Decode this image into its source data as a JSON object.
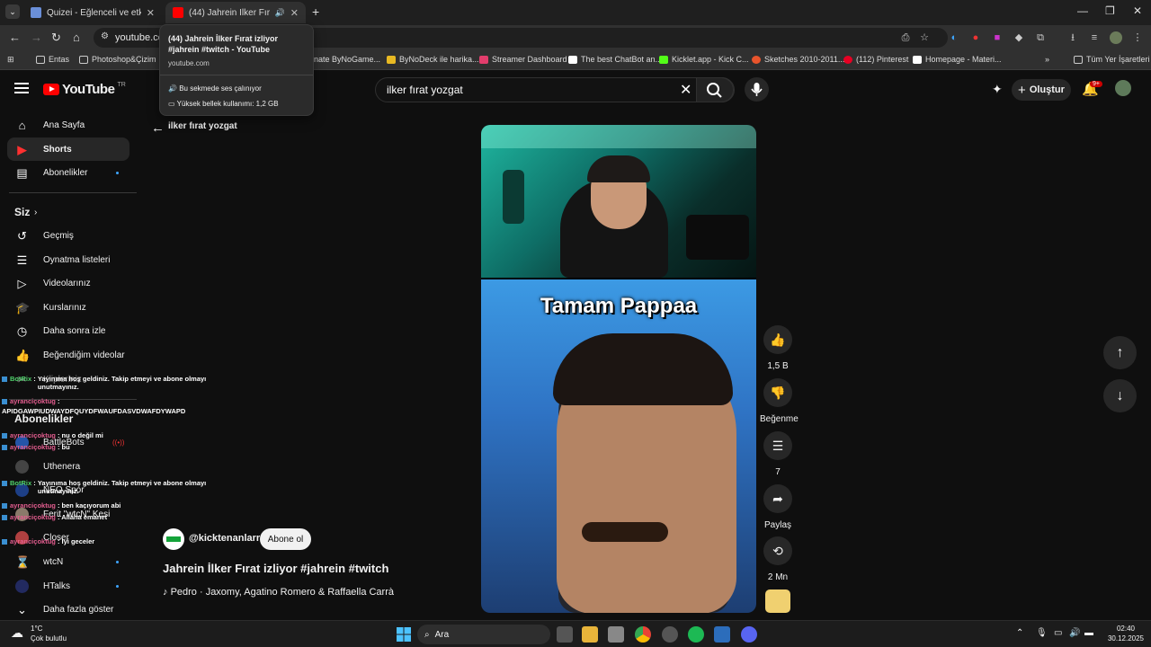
{
  "browser": {
    "tabs": [
      {
        "title": "Quizei - Eğlenceli ve etkileşimli",
        "active": false
      },
      {
        "title": "(44) Jahrein İlker Fırat izliyor",
        "active": true
      }
    ],
    "url": "youtube.com",
    "bookmarks": [
      "Entas",
      "Photoshop&Çizim",
      "onate ByNoGame...",
      "ByNoDeck ile harika...",
      "Streamer Dashboard",
      "The best ChatBot an...",
      "Kicklet.app - Kick C...",
      "Sketches 2010-2011...",
      "(112) Pinterest",
      "Homepage - Materi...",
      "Tüm Yer İşaretleri"
    ],
    "tooltip": {
      "title": "(44) Jahrein İlker Fırat izliyor #jahrein #twitch - YouTube",
      "domain": "youtube.com",
      "audio": "Bu sekmede ses çalınıyor",
      "memory": "Yüksek bellek kullanımı: 1,2 GB"
    }
  },
  "header": {
    "logo": "YouTube",
    "logo_region": "TR",
    "search_query": "ilker fırat yozgat",
    "create_label": "Oluştur",
    "notifications": "9+"
  },
  "sidebar": {
    "main": [
      {
        "label": "Ana Sayfa",
        "icon": "home-icon"
      },
      {
        "label": "Shorts",
        "icon": "shorts-icon"
      },
      {
        "label": "Abonelikler",
        "icon": "subscriptions-icon"
      }
    ],
    "you_heading": "Siz",
    "you": [
      {
        "label": "Geçmiş",
        "icon": "history-icon"
      },
      {
        "label": "Oynatma listeleri",
        "icon": "playlists-icon"
      },
      {
        "label": "Videolarınız",
        "icon": "your-videos-icon"
      },
      {
        "label": "Kurslarınız",
        "icon": "courses-icon"
      },
      {
        "label": "Daha sonra izle",
        "icon": "watch-later-icon"
      },
      {
        "label": "Beğendiğim videolar",
        "icon": "liked-icon"
      },
      {
        "label": "Klipleriniz",
        "icon": "clips-icon"
      }
    ],
    "subs_heading": "Abonelikler",
    "subscriptions": [
      "BattleBots",
      "Uthenera",
      "NEO Spor",
      "Ferit \"wtcN\" Kesi",
      "Closer",
      "wtcN",
      "HTalks"
    ],
    "show_more": "Daha fazla göster"
  },
  "chat": [
    {
      "user": "BotRix",
      "text": "Yayınıma hoş geldiniz. Takip etmeyi ve abone olmayı unutmayınız."
    },
    {
      "user": "ayranciçoktug",
      "text": ""
    },
    {
      "user": "",
      "text": "APIDGAWPIUDWAYDFQUYDFWAUFDASVDWAFDYWAPD"
    },
    {
      "user": "ayranciçoktug",
      "text": "nu o değil mi"
    },
    {
      "user": "ayranciçoktug",
      "text": "bu"
    },
    {
      "user": "BotRix",
      "text": "Yayınıma hoş geldiniz. Takip etmeyi ve abone olmayı unutmayınız."
    },
    {
      "user": "ayranciçoktug",
      "text": "ben kaçıyorum abi"
    },
    {
      "user": "ayranciçoktug",
      "text": "Allaha emanet"
    },
    {
      "user": "ayranciçoktug",
      "text": "İyi geceler"
    }
  ],
  "short": {
    "back_query": "ilker fırat yozgat",
    "caption": "Tamam Pappaa",
    "channel": "@kicktenanlarr",
    "subscribe": "Abone ol",
    "title": "Jahrein İlker Fırat izliyor #jahrein #twitch",
    "music": "Pedro · Jaxomy, Agatino Romero & Raffaella Carrà",
    "likes": "1,5 B",
    "dislike_label": "Beğenme",
    "comments": "7",
    "share_label": "Paylaş",
    "remix": "2 Mn"
  },
  "taskbar": {
    "weather_temp": "1°C",
    "weather_desc": "Çok bulutlu",
    "search_label": "Ara",
    "time": "02:40",
    "date": "30.12.2025"
  }
}
